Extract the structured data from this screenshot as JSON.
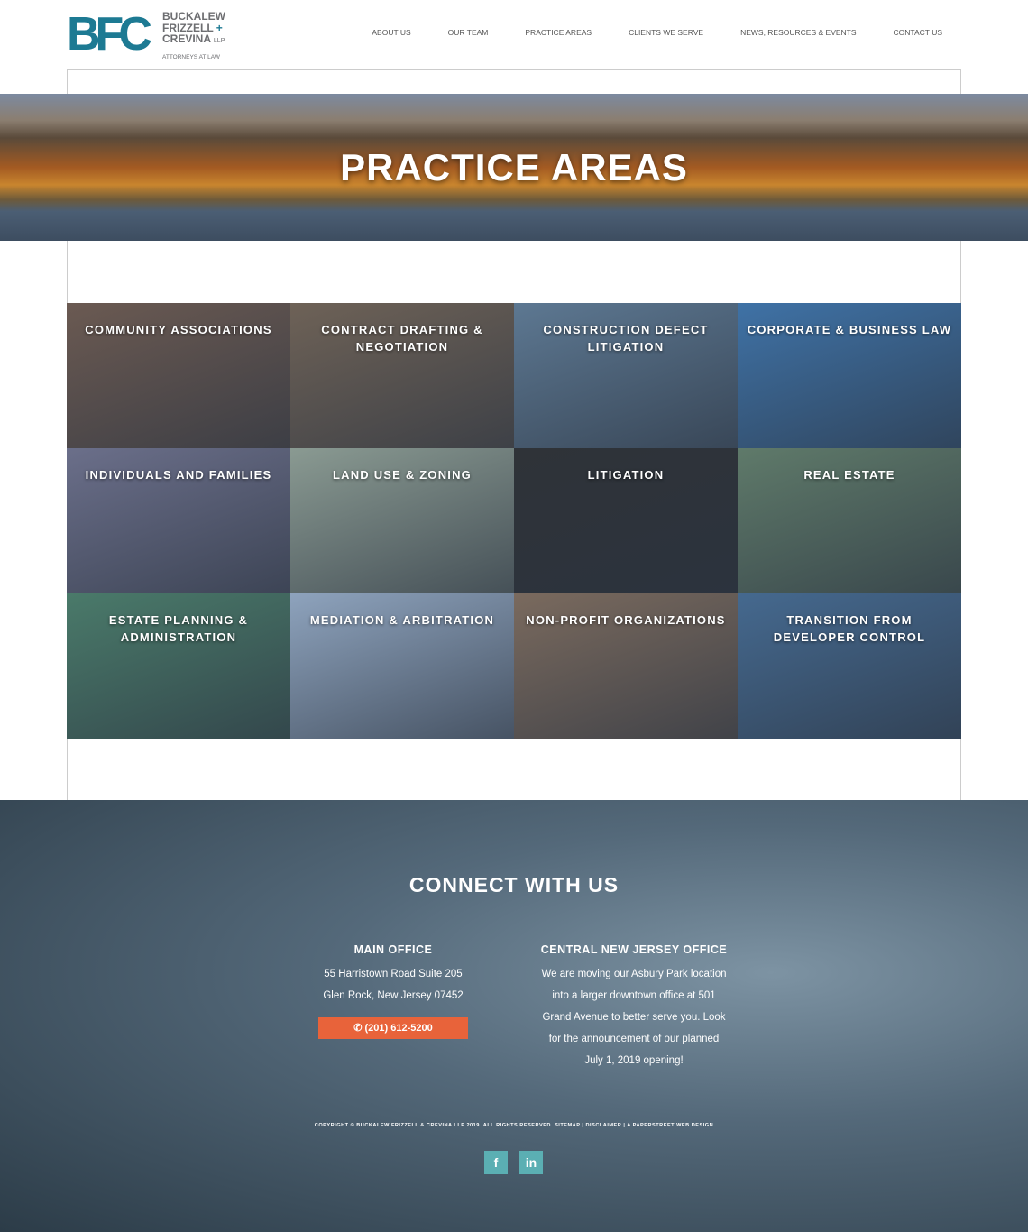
{
  "logo": {
    "mark": "BFC",
    "line1": "BUCKALEW",
    "line2": "FRIZZELL",
    "plus": "+",
    "line3": "CREVINA",
    "llp": "LLP",
    "sub": "ATTORNEYS AT LAW"
  },
  "nav": [
    "About Us",
    "Our Team",
    "Practice Areas",
    "Clients We Serve",
    "News, Resources & Events",
    "Contact Us"
  ],
  "hero": {
    "title": "PRACTICE AREAS"
  },
  "practice_areas": [
    {
      "label": "COMMUNITY ASSOCIATIONS",
      "color": "#6b5a52"
    },
    {
      "label": "CONTRACT DRAFTING & NEGOTIATION",
      "color": "#6e6257"
    },
    {
      "label": "CONSTRUCTION DEFECT LITIGATION",
      "color": "#5d7892"
    },
    {
      "label": "CORPORATE & BUSINESS LAW",
      "color": "#3f72a6"
    },
    {
      "label": "INDIVIDUALS AND FAMILIES",
      "color": "#6b6f8a"
    },
    {
      "label": "LAND USE & ZONING",
      "color": "#8a9a92"
    },
    {
      "label": "LITIGATION",
      "color": "#2f3338"
    },
    {
      "label": "REAL ESTATE",
      "color": "#5f7a6a"
    },
    {
      "label": "ESTATE PLANNING & ADMINISTRATION",
      "color": "#4a7a6a"
    },
    {
      "label": "MEDIATION & ARBITRATION",
      "color": "#8ea3bd"
    },
    {
      "label": "NON-PROFIT ORGANIZATIONS",
      "color": "#7a6a5e"
    },
    {
      "label": "TRANSITION FROM DEVELOPER CONTROL",
      "color": "#45698f"
    }
  ],
  "footer": {
    "title": "CONNECT WITH US",
    "main_office": {
      "title": "MAIN OFFICE",
      "lines": [
        "55 Harristown Road Suite 205",
        "Glen Rock, New Jersey 07452"
      ],
      "phone": "(201) 612-5200"
    },
    "central_office": {
      "title": "CENTRAL NEW JERSEY OFFICE",
      "lines": [
        "We are moving our Asbury Park location",
        "into a larger downtown office at 501",
        "Grand Avenue to better serve you. Look",
        "for the announcement of our planned",
        "July 1, 2019 opening!"
      ]
    },
    "copyright": "COPYRIGHT © BUCKALEW FRIZZELL & CREVINA LLP 2019. ALL RIGHTS RESERVED. SITEMAP | DISCLAIMER | A PAPERSTREET WEB DESIGN",
    "social": [
      "f",
      "in"
    ]
  }
}
